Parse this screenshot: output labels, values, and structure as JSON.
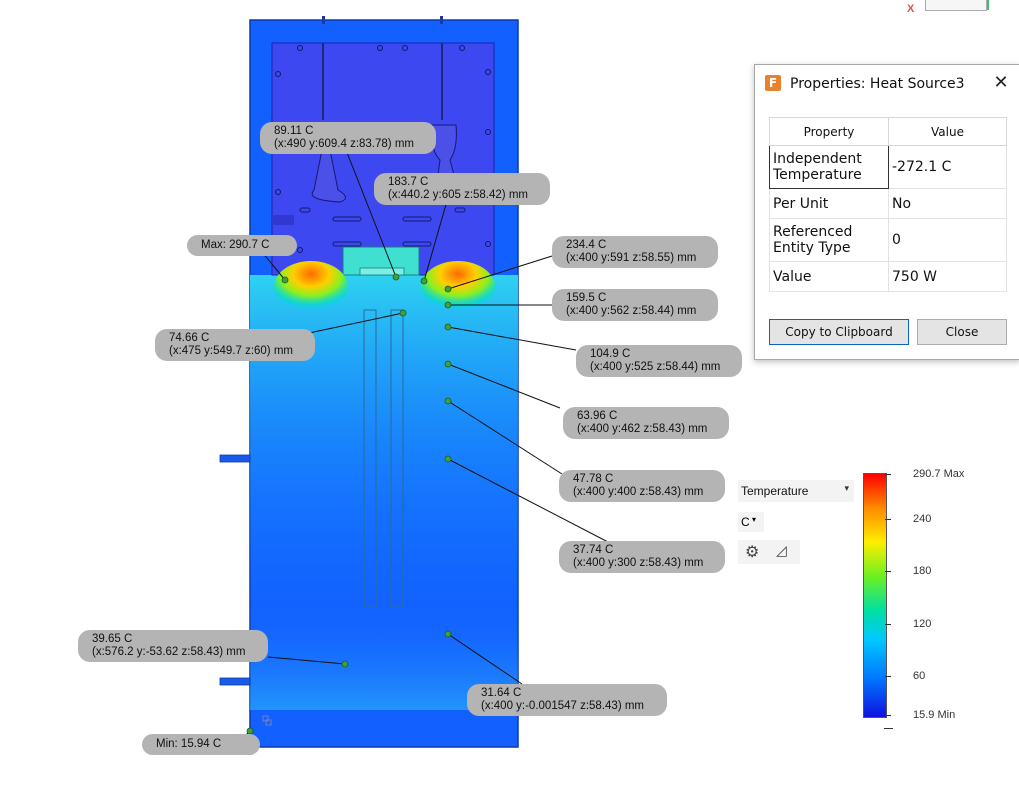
{
  "probes": {
    "p1": {
      "temp": "89.11 C",
      "coords": "(x:490 y:609.4 z:83.78) mm"
    },
    "p2": {
      "temp": "183.7 C",
      "coords": "(x:440.2 y:605 z:58.42) mm"
    },
    "max": {
      "label": "Max: 290.7 C"
    },
    "p3": {
      "temp": "234.4 C",
      "coords": "(x:400 y:591 z:58.55) mm"
    },
    "p4": {
      "temp": "159.5 C",
      "coords": "(x:400 y:562 z:58.44) mm"
    },
    "p5": {
      "temp": "74.66 C",
      "coords": "(x:475 y:549.7 z:60) mm"
    },
    "p6": {
      "temp": "104.9 C",
      "coords": "(x:400 y:525 z:58.44) mm"
    },
    "p7": {
      "temp": "63.96 C",
      "coords": "(x:400 y:462 z:58.43) mm"
    },
    "p8": {
      "temp": "47.78 C",
      "coords": "(x:400 y:400 z:58.43) mm"
    },
    "p9": {
      "temp": "37.74 C",
      "coords": "(x:400 y:300 z:58.43) mm"
    },
    "p10": {
      "temp": "39.65 C",
      "coords": "(x:576.2 y:-53.62 z:58.43) mm"
    },
    "p11": {
      "temp": "31.64 C",
      "coords": "(x:400 y:-0.001547 z:58.43) mm"
    },
    "min": {
      "label": "Min: 15.94 C"
    }
  },
  "dialog": {
    "title": "Properties: Heat Source3",
    "app_icon": "F",
    "close_glyph": "✕",
    "header_property": "Property",
    "header_value": "Value",
    "rows": [
      {
        "property": "Independent Temperature",
        "value": "-272.1 C"
      },
      {
        "property": "Per Unit",
        "value": "No"
      },
      {
        "property": "Referenced Entity Type",
        "value": "0"
      },
      {
        "property": "Value",
        "value": "750 W"
      }
    ],
    "copy_label": "Copy to Clipboard",
    "close_label": "Close"
  },
  "results": {
    "result_type": "Temperature",
    "unit": "C",
    "caret": "▾"
  },
  "legend": {
    "max_label": "290.7 Max",
    "ticks": [
      "240",
      "180",
      "120",
      "60"
    ],
    "min_label": "15.9 Min",
    "colors": [
      "#ff0000",
      "#ffee00",
      "#00e0a0",
      "#0078ff",
      "#1010e0"
    ]
  },
  "view_cube": {
    "axis_label": "X"
  },
  "icons": {
    "gear": "gear-icon",
    "legend-options": "triangle-ruler-icon",
    "dropdown": "chevron-down-icon",
    "close": "close-icon",
    "fusion-app": "app-logo-icon"
  }
}
